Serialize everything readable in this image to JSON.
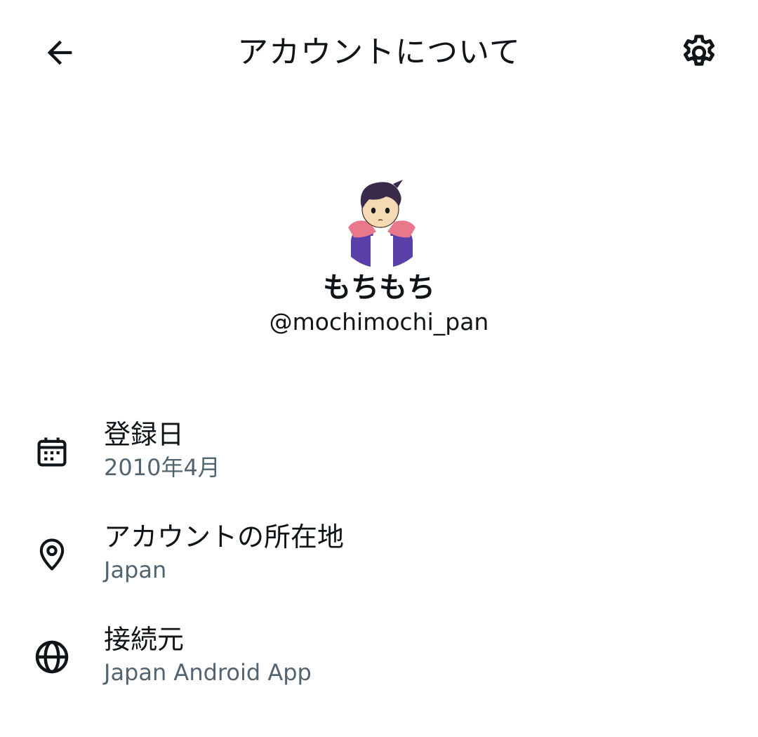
{
  "header": {
    "title": "アカウントについて",
    "back_icon": "arrow-left-icon",
    "settings_icon": "gear-icon"
  },
  "profile": {
    "display_name": "もちもち",
    "handle": "@mochimochi_pan",
    "avatar_icon": "avatar-illustration"
  },
  "info": [
    {
      "icon": "calendar-icon",
      "label": "登録日",
      "value": "2010年4月"
    },
    {
      "icon": "location-pin-icon",
      "label": "アカウントの所在地",
      "value": "Japan"
    },
    {
      "icon": "globe-icon",
      "label": "接続元",
      "value": "Japan Android App"
    }
  ],
  "colors": {
    "text_primary": "#0f1419",
    "text_secondary": "#536471",
    "background": "#ffffff"
  }
}
